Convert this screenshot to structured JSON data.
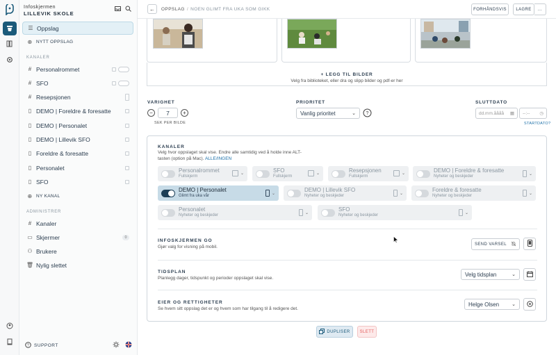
{
  "brand": {
    "line1": "Infoskjermen",
    "line2": "LILLEVIK SKOLE"
  },
  "sidebar": {
    "top_items": [
      {
        "label": "Oppslag",
        "icon": "list-icon"
      },
      {
        "label": "NYTT OPPSLAG",
        "icon": "plus-circle-icon"
      }
    ],
    "channels_title": "KANALER",
    "channels": [
      {
        "label": "Personalrommet",
        "icon": "hash-icon"
      },
      {
        "label": "SFO",
        "icon": "hash-icon"
      },
      {
        "label": "Resepsjonen",
        "icon": "hash-icon"
      },
      {
        "label": "DEMO | Foreldre & foresatte",
        "icon": "phone-icon"
      },
      {
        "label": "DEMO | Personalet",
        "icon": "phone-icon"
      },
      {
        "label": "DEMO | Lillevik SFO",
        "icon": "phone-icon"
      },
      {
        "label": "Foreldre & foresatte",
        "icon": "phone-icon"
      },
      {
        "label": "Personalet",
        "icon": "phone-icon"
      },
      {
        "label": "SFO",
        "icon": "phone-icon"
      }
    ],
    "new_channel": "NY KANAL",
    "admin_title": "ADMINISTRER",
    "admin": [
      {
        "label": "Kanaler",
        "icon": "hash-icon"
      },
      {
        "label": "Skjermer",
        "icon": "monitor-icon",
        "badge": "0"
      },
      {
        "label": "Brukere",
        "icon": "users-icon"
      },
      {
        "label": "Nylig slettet",
        "icon": "trash-icon"
      }
    ],
    "support": "SUPPORT"
  },
  "topbar": {
    "crumb_root": "OPPSLAG",
    "crumb_sep": "/",
    "crumb_current": "NOEN GLIMT FRA UKA SOM GIKK",
    "preview": "FORHÅNDSVIS",
    "save": "LAGRE",
    "more": "..."
  },
  "upload": {
    "title": "+ LEGG TIL BILDER",
    "hint": "Velg fra biblioteket, eller dra og slipp bilder og pdf-er her"
  },
  "duration": {
    "label": "VARIGHET",
    "value": "7",
    "hint": "SEK PER BILDE"
  },
  "priority": {
    "label": "PRIORITET",
    "value": "Vanlig prioritet"
  },
  "enddate": {
    "label": "SLUTTDATO",
    "date_placeholder": "dd.mm.åååå",
    "time_placeholder": "--:--",
    "link": "STARTDATO?"
  },
  "channels_section": {
    "title": "KANALER",
    "desc1": "Velg hvor oppslaget skal vise. Endre alle samtidig ved å holde inne ALT-",
    "desc2": "tasten (option på Mac).",
    "all": "ALLE",
    "slash": "/",
    "none": "INGEN",
    "items": [
      {
        "name": "Personalrommet",
        "sub": "Fullskjerm",
        "on": false
      },
      {
        "name": "SFO",
        "sub": "Fullskjerm",
        "on": false
      },
      {
        "name": "Resepsjonen",
        "sub": "Fullskjerm",
        "on": false
      },
      {
        "name": "DEMO | Foreldre & foresatte",
        "sub": "Nyheter og beskjeder",
        "on": false
      },
      {
        "name": "DEMO | Personalet",
        "sub": "Glimt fra uka vår",
        "on": true
      },
      {
        "name": "DEMO | Lillevik SFO",
        "sub": "Nyheter og beskjeder",
        "on": false
      },
      {
        "name": "Foreldre & foresatte",
        "sub": "Nyheter og beskjeder",
        "on": false
      },
      {
        "name": "Personalet",
        "sub": "Nyheter og beskjeder",
        "on": false
      },
      {
        "name": "SFO",
        "sub": "Nyheter og beskjeder",
        "on": false
      }
    ]
  },
  "go_section": {
    "title": "INFOSKJERMEN GO",
    "desc": "Gjør valg for visning på mobil.",
    "button": "SEND VARSEL"
  },
  "schedule": {
    "title": "TIDSPLAN",
    "desc": "Planlegg dager, tidspunkt og perioder oppslaget skal vise.",
    "value": "Velg tidsplan"
  },
  "owner": {
    "title": "EIER OG RETTIGHETER",
    "desc": "Se hvem sitt oppslag det er og hvem som har tilgang til å redigere det.",
    "value": "Helge Olsen"
  },
  "footer": {
    "duplicate": "DUPLISER",
    "delete": "SLETT"
  },
  "colors": {
    "accent": "#1b5a7a",
    "active_chip": "#c7dbe7",
    "danger": "#e35b5b"
  }
}
